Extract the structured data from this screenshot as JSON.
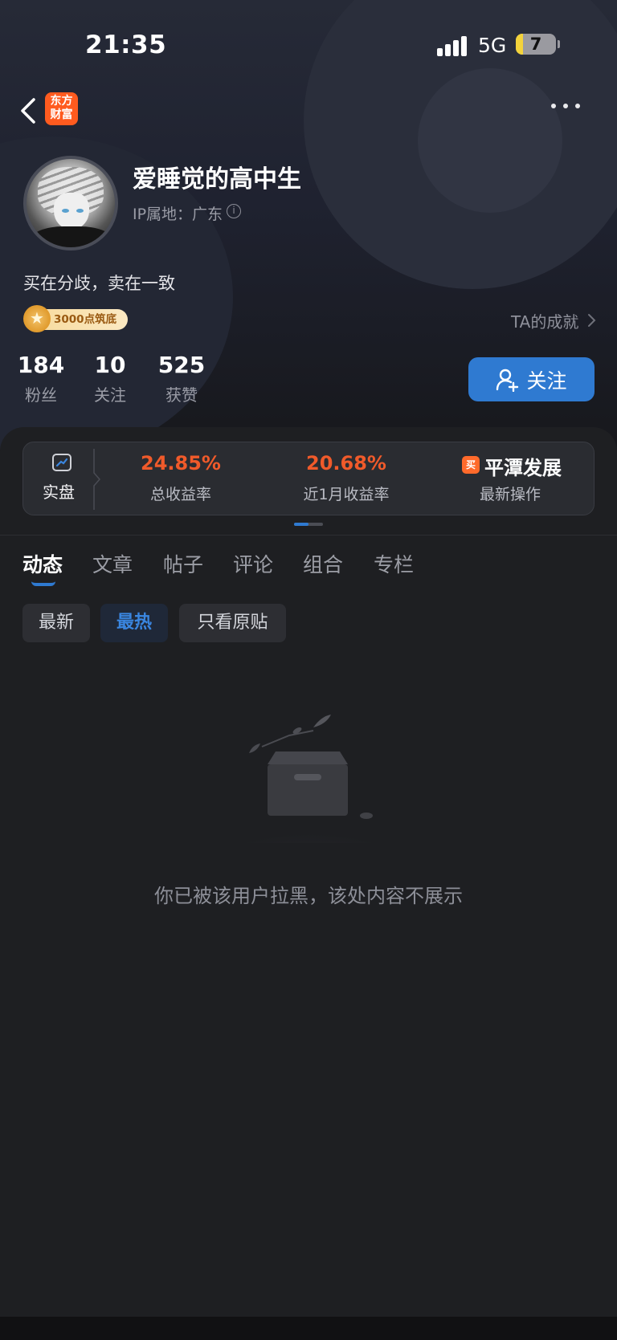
{
  "status_bar": {
    "time": "21:35",
    "network": "5G",
    "battery": "7"
  },
  "nav": {
    "app_logo_line1": "东方",
    "app_logo_line2": "财富"
  },
  "profile": {
    "username": "爱睡觉的高中生",
    "ip_location": "IP属地：广东",
    "bio": "买在分歧，卖在一致",
    "badge": "3000点筑底",
    "achievements_link": "TA的成就"
  },
  "stats": [
    {
      "value": "184",
      "label": "粉丝"
    },
    {
      "value": "10",
      "label": "关注"
    },
    {
      "value": "525",
      "label": "获赞"
    }
  ],
  "follow_button": "关注",
  "performance": {
    "live_label": "实盘",
    "total_return": {
      "value": "24.85%",
      "label": "总收益率"
    },
    "month_return": {
      "value": "20.68%",
      "label": "近1月收益率"
    },
    "latest_op": {
      "tag": "买",
      "name": "平潭发展",
      "label": "最新操作"
    }
  },
  "tabs": [
    "动态",
    "文章",
    "帖子",
    "评论",
    "组合",
    "专栏"
  ],
  "filters": [
    "最新",
    "最热",
    "只看原贴"
  ],
  "empty_message": "你已被该用户拉黑，该处内容不展示",
  "colors": {
    "accent": "#2f7ad1",
    "return_red": "#f05a2a",
    "brand_orange": "#ff5b1f"
  }
}
